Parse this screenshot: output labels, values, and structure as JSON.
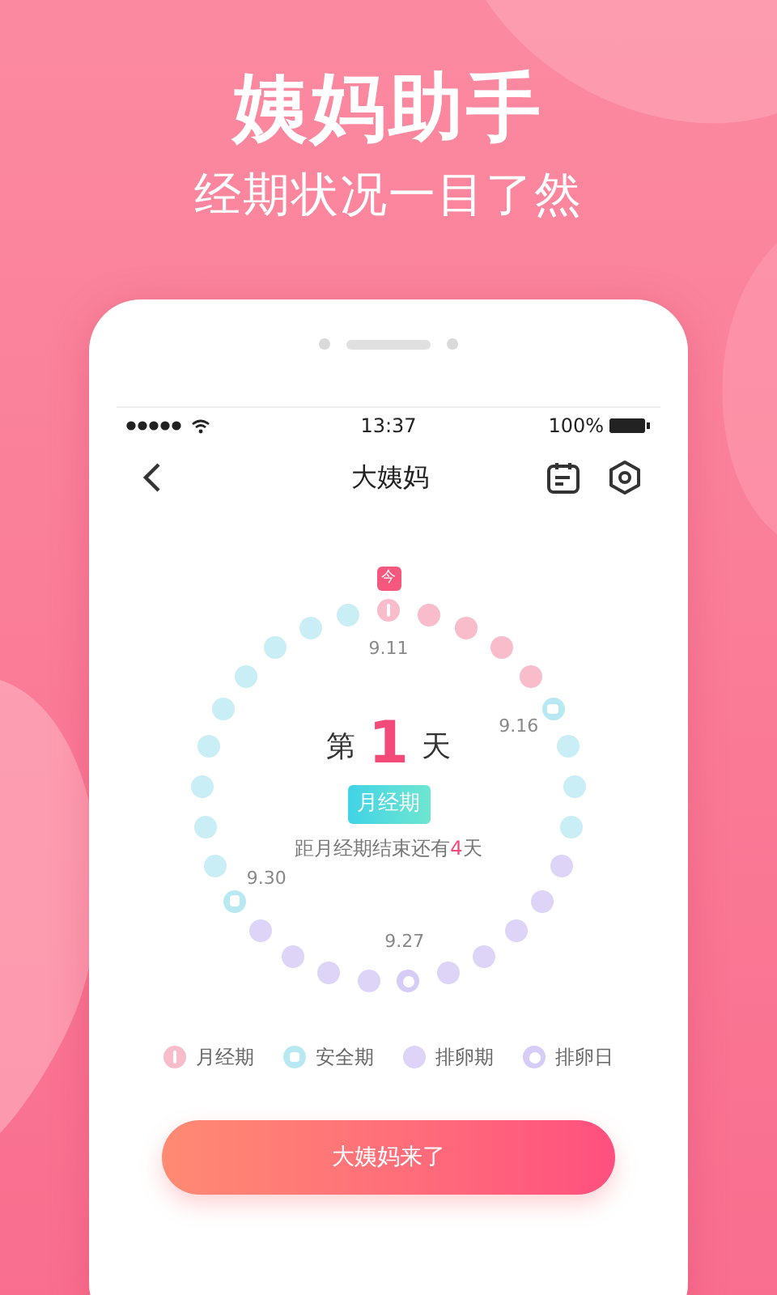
{
  "headline": "姨妈助手",
  "subheadline": "经期状况一目了然",
  "status_bar": {
    "time": "13:37",
    "battery": "100%"
  },
  "nav": {
    "title": "大姨妈"
  },
  "cycle": {
    "today_badge": "今",
    "dots": [
      {
        "kind": "period",
        "today": true,
        "label": "9.11"
      },
      {
        "kind": "period",
        "today": false
      },
      {
        "kind": "period",
        "today": false
      },
      {
        "kind": "period",
        "today": false
      },
      {
        "kind": "period",
        "today": false
      },
      {
        "kind": "safe-marker",
        "today": false,
        "label": "9.16"
      },
      {
        "kind": "safe",
        "today": false
      },
      {
        "kind": "safe",
        "today": false
      },
      {
        "kind": "safe",
        "today": false
      },
      {
        "kind": "ovulation",
        "today": false
      },
      {
        "kind": "ovulation",
        "today": false
      },
      {
        "kind": "ovulation",
        "today": false
      },
      {
        "kind": "ovulation",
        "today": false
      },
      {
        "kind": "ovulation",
        "today": false
      },
      {
        "kind": "ovulation-day",
        "today": false,
        "label": "9.27"
      },
      {
        "kind": "ovulation",
        "today": false
      },
      {
        "kind": "ovulation",
        "today": false
      },
      {
        "kind": "ovulation",
        "today": false
      },
      {
        "kind": "ovulation",
        "today": false
      },
      {
        "kind": "safe-marker",
        "today": false,
        "label": "9.30"
      },
      {
        "kind": "safe",
        "today": false
      },
      {
        "kind": "safe",
        "today": false
      },
      {
        "kind": "safe",
        "today": false
      },
      {
        "kind": "safe",
        "today": false
      },
      {
        "kind": "safe",
        "today": false
      },
      {
        "kind": "safe",
        "today": false
      },
      {
        "kind": "safe",
        "today": false
      },
      {
        "kind": "safe",
        "today": false
      },
      {
        "kind": "safe",
        "today": false
      }
    ],
    "day_prefix": "第",
    "day_number": "1",
    "day_suffix": "天",
    "phase": "月经期",
    "countdown": {
      "prefix": "距月经期结束还有",
      "count": "4",
      "suffix": "天"
    }
  },
  "legend": [
    {
      "kind": "period",
      "label": "月经期"
    },
    {
      "kind": "safe-marker",
      "label": "安全期"
    },
    {
      "kind": "ovulation",
      "label": "排卵期"
    },
    {
      "kind": "ovulation-day",
      "label": "排卵日"
    }
  ],
  "action_button": "大姨妈来了"
}
